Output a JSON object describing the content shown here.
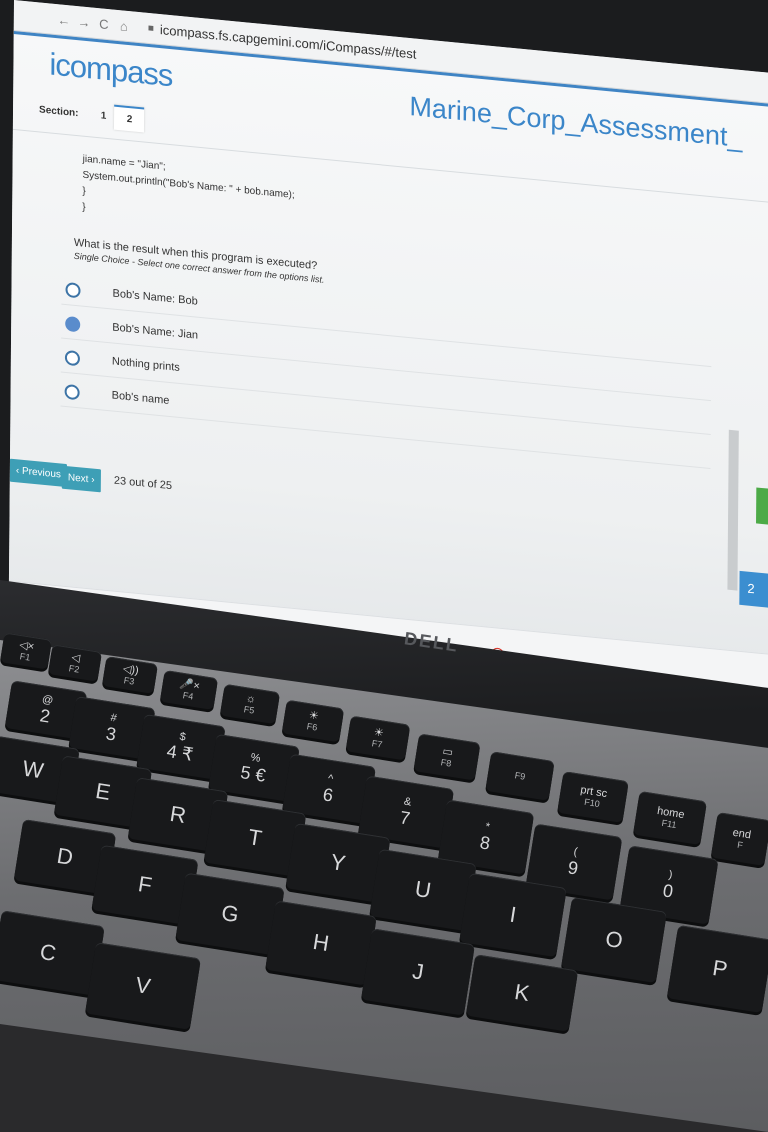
{
  "browser": {
    "url": "icompass.fs.capgemini.com/iCompass/#/test",
    "back": "←",
    "forward": "→",
    "reload": "C",
    "home": "⌂",
    "lock": "🔒"
  },
  "app": {
    "logo": "icompass",
    "assessment_title": "Marine_Corp_Assessment_",
    "section_label": "Section:",
    "sections": [
      "1",
      "2"
    ]
  },
  "code_lines": [
    "jian.name = \"Jian\";",
    "System.out.println(\"Bob's Name: \" + bob.name);",
    "}",
    "}"
  ],
  "question": {
    "text": "What is the result when this program is executed?",
    "instruction": "Single Choice - Select one correct answer from the options list."
  },
  "options": [
    {
      "label": "Bob's Name: Bob",
      "selected": false
    },
    {
      "label": "Bob's Name: Jian",
      "selected": true
    },
    {
      "label": "Nothing prints",
      "selected": false
    },
    {
      "label": "Bob's name",
      "selected": false
    }
  ],
  "footer": {
    "previous": "‹ Previous",
    "next": "Next ›",
    "counter": "23 out of 25"
  },
  "side_button_text": "2",
  "taskbar_icons": [
    "windows-icon",
    "search-icon",
    "task-view-icon",
    "file-explorer-icon",
    "chrome-icon"
  ],
  "taskbar_glyphs": [
    "⊞",
    "⚲",
    "▪",
    "▰",
    "◉"
  ],
  "laptop_brand": "DELL",
  "keys": {
    "fn_row": [
      {
        "top": "◁×",
        "main": "F1"
      },
      {
        "top": "◁",
        "main": "F2"
      },
      {
        "top": "◁))",
        "main": "F3"
      },
      {
        "top": "🎤×",
        "main": "F4"
      },
      {
        "top": "☼",
        "main": "F5"
      },
      {
        "top": "☀",
        "main": "F6"
      },
      {
        "top": "☀",
        "main": "F7"
      },
      {
        "top": "▭",
        "main": "F8"
      },
      {
        "top": "",
        "main": "F9"
      },
      {
        "top": "prt sc",
        "main": "F10"
      },
      {
        "top": "home",
        "main": "F11"
      },
      {
        "top": "end",
        "main": "F"
      }
    ],
    "number_row": [
      {
        "top": "@",
        "main": "2"
      },
      {
        "top": "#",
        "main": "3"
      },
      {
        "top": "$",
        "main": "4 ₹"
      },
      {
        "top": "%",
        "main": "5 €"
      },
      {
        "top": "^",
        "main": "6"
      },
      {
        "top": "&",
        "main": "7"
      },
      {
        "top": "*",
        "main": "8"
      },
      {
        "top": "(",
        "main": "9"
      },
      {
        "top": ")",
        "main": "0"
      }
    ],
    "row_qwerty": [
      "W",
      "E",
      "R",
      "T",
      "Y",
      "U",
      "I",
      "O",
      "P"
    ],
    "row_asdf": [
      "D",
      "F",
      "G",
      "H",
      "J",
      "K"
    ],
    "row_zxcv": [
      "C",
      "V"
    ]
  }
}
